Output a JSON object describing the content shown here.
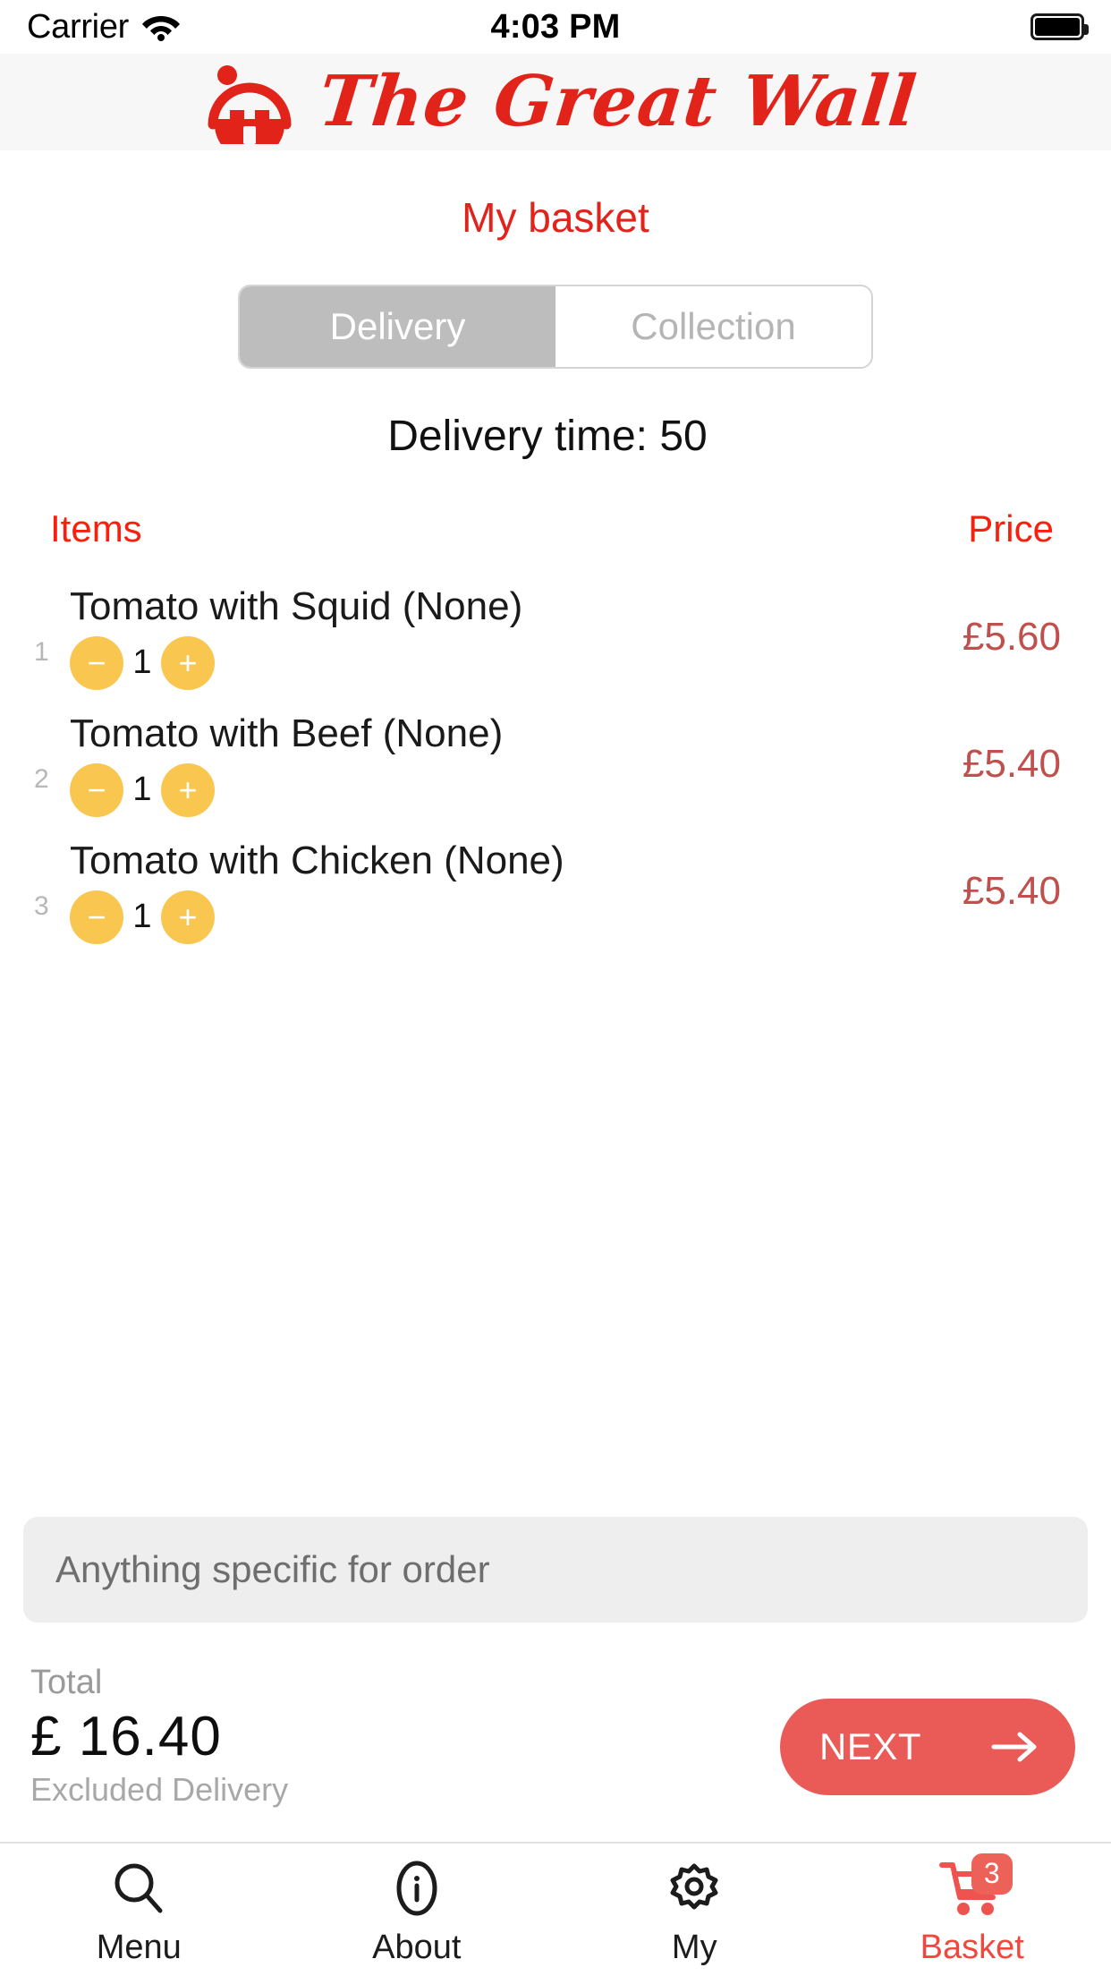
{
  "status_bar": {
    "carrier": "Carrier",
    "time": "4:03 PM",
    "wifi_icon": "wifi-icon",
    "battery_icon": "battery-full-icon"
  },
  "brand": {
    "name": "The Great Wall",
    "logo_icon": "great-wall-logo-icon",
    "brand_color": "#e2231a"
  },
  "page": {
    "title": "My basket"
  },
  "fulfilment": {
    "options": [
      {
        "label": "Delivery",
        "selected": true
      },
      {
        "label": "Collection",
        "selected": false
      }
    ],
    "delivery_time_text": "Delivery time: 50"
  },
  "table": {
    "header": {
      "items": "Items",
      "price": "Price"
    },
    "rows": [
      {
        "index": "1",
        "name": "Tomato with Squid (None)",
        "decrement": "−",
        "quantity": "1",
        "increment": "+",
        "price": "£5.60"
      },
      {
        "index": "2",
        "name": "Tomato with Beef (None)",
        "decrement": "−",
        "quantity": "1",
        "increment": "+",
        "price": "£5.40"
      },
      {
        "index": "3",
        "name": "Tomato with Chicken (None)",
        "decrement": "−",
        "quantity": "1",
        "increment": "+",
        "price": "£5.40"
      }
    ]
  },
  "note": {
    "placeholder": "Anything specific for order",
    "value": ""
  },
  "summary": {
    "total_label": "Total",
    "total_amount": "£ 16.40",
    "total_note": "Excluded Delivery",
    "next_label": "NEXT",
    "next_icon": "arrow-right-icon",
    "next_color": "#ea5a57"
  },
  "tabbar": {
    "tabs": [
      {
        "label": "Menu",
        "icon": "search-icon",
        "active": false
      },
      {
        "label": "About",
        "icon": "info-circle-icon",
        "active": false
      },
      {
        "label": "My",
        "icon": "gear-icon",
        "active": false
      },
      {
        "label": "Basket",
        "icon": "shopping-cart-icon",
        "active": true,
        "badge": "3"
      }
    ]
  }
}
